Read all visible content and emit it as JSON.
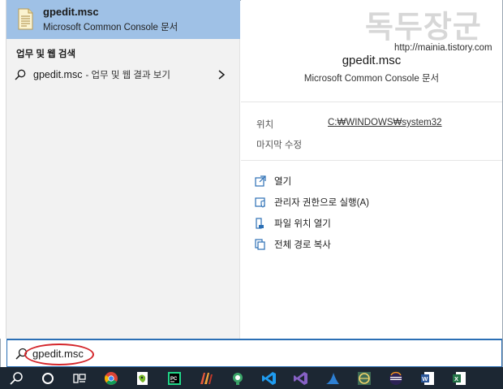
{
  "best_match": {
    "title": "gpedit.msc",
    "subtitle": "Microsoft Common Console 문서"
  },
  "web_section": {
    "heading": "업무 및 웹 검색",
    "query": "gpedit.msc",
    "suffix": "- 업무 및 웹 결과 보기"
  },
  "watermark": {
    "logo": "독두장군",
    "url": "http://mainia.tistory.com"
  },
  "detail": {
    "title": "gpedit.msc",
    "subtitle": "Microsoft Common Console 문서",
    "location_label": "위치",
    "location_value": "C:₩WINDOWS₩system32",
    "modified_label": "마지막 수정",
    "actions": [
      {
        "label": "열기",
        "icon": "open-icon"
      },
      {
        "label": "관리자 권한으로 실행(A)",
        "icon": "run-as-admin-icon"
      },
      {
        "label": "파일 위치 열기",
        "icon": "file-location-icon"
      },
      {
        "label": "전체 경로 복사",
        "icon": "copy-path-icon"
      }
    ]
  },
  "search": {
    "value": "gpedit.msc",
    "placeholder": ""
  },
  "taskbar": {
    "items": [
      "search-icon",
      "cortana-icon",
      "task-view-icon",
      "chrome-icon",
      "notepadpp-icon",
      "pycharm-icon",
      "cleanup-icon",
      "app-icon",
      "vscode-icon",
      "visual-studio-icon",
      "shark-icon",
      "circle-app-icon",
      "eclipse-icon",
      "word-icon",
      "excel-icon"
    ]
  },
  "colors": {
    "selected": "#9fc1e6",
    "accent": "#2b6fb5",
    "taskbar": "#1c2733",
    "highlight_circle": "#d4252a"
  }
}
